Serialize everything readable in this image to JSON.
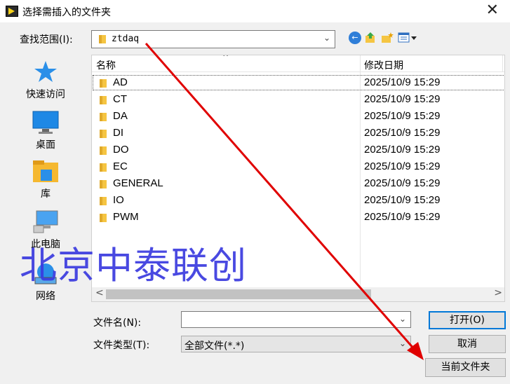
{
  "window": {
    "title": "选择需插入的文件夹",
    "close_glyph": "✕"
  },
  "lookin": {
    "label": "查找范围(I):",
    "value": "ztdaq"
  },
  "toolbar": {
    "back_glyph": "←"
  },
  "places": [
    {
      "label": "快速访问",
      "icon": "star-icon"
    },
    {
      "label": "桌面",
      "icon": "desktop-icon"
    },
    {
      "label": "库",
      "icon": "library-icon"
    },
    {
      "label": "此电脑",
      "icon": "computer-icon"
    },
    {
      "label": "网络",
      "icon": "network-icon"
    }
  ],
  "filelist": {
    "columns": {
      "name": "名称",
      "date": "修改日期"
    },
    "rows": [
      {
        "name": "AD",
        "date": "2025/10/9 15:29"
      },
      {
        "name": "CT",
        "date": "2025/10/9 15:29"
      },
      {
        "name": "DA",
        "date": "2025/10/9 15:29"
      },
      {
        "name": "DI",
        "date": "2025/10/9 15:29"
      },
      {
        "name": "DO",
        "date": "2025/10/9 15:29"
      },
      {
        "name": "EC",
        "date": "2025/10/9 15:29"
      },
      {
        "name": "GENERAL",
        "date": "2025/10/9 15:29"
      },
      {
        "name": "IO",
        "date": "2025/10/9 15:29"
      },
      {
        "name": "PWM",
        "date": "2025/10/9 15:29"
      }
    ],
    "sort_caret": "^",
    "scroll_left": "<",
    "scroll_right": ">"
  },
  "form": {
    "filename_label": "文件名(N):",
    "filename_value": "",
    "filetype_label": "文件类型(T):",
    "filetype_value": "全部文件(*.*)"
  },
  "buttons": {
    "open": "打开(O)",
    "cancel": "取消",
    "current_folder": "当前文件夹"
  },
  "watermark": "北京中泰联创",
  "colors": {
    "accent": "#0078d7",
    "watermark": "#3a3adf",
    "annotation_arrow": "#e00000",
    "folder": "#f5c542"
  }
}
